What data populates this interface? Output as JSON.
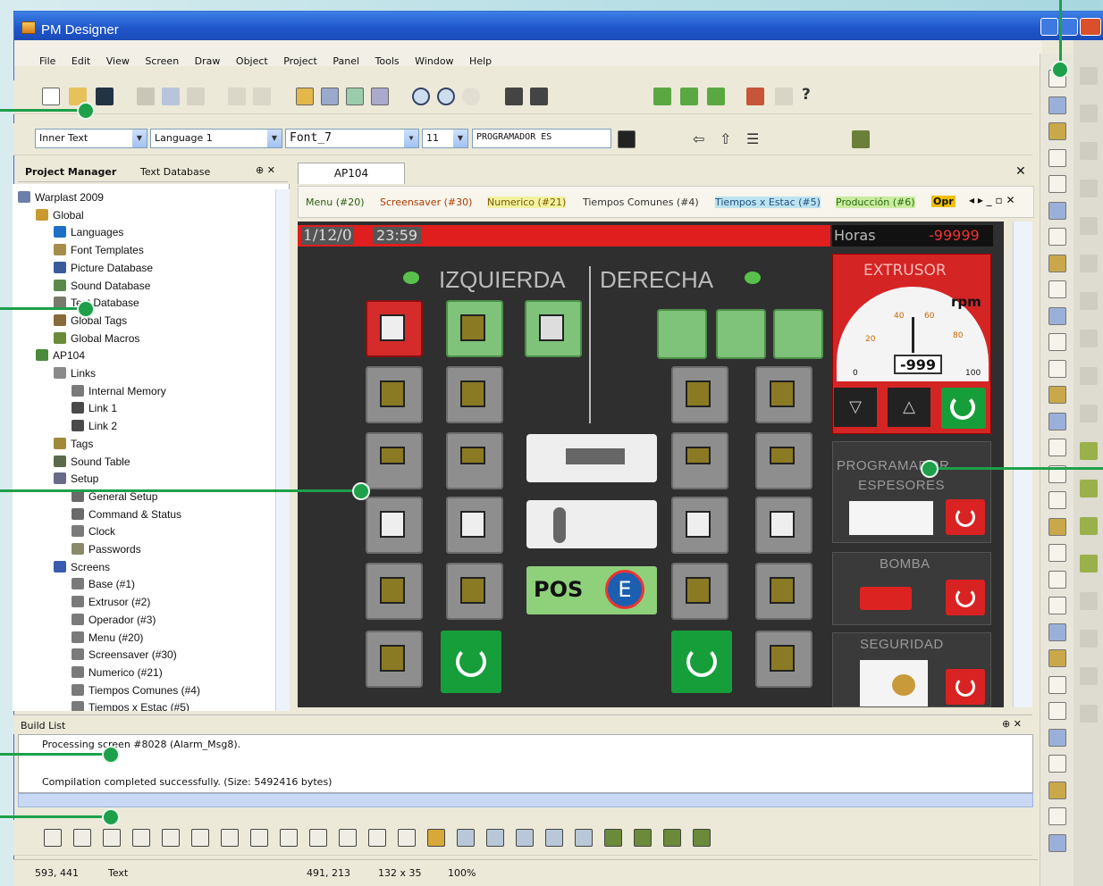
{
  "window": {
    "title": "PM Designer"
  },
  "menu": [
    "File",
    "Edit",
    "View",
    "Screen",
    "Draw",
    "Object",
    "Project",
    "Panel",
    "Tools",
    "Window",
    "Help"
  ],
  "toolbar2": {
    "inner_text": "Inner Text",
    "language": "Language 1",
    "font": "Font_7",
    "size": "11",
    "text": "PROGRAMADOR ES"
  },
  "project_manager": {
    "tab1": "Project Manager",
    "tab2": "Text Database",
    "tree": [
      "Warplast 2009",
      "Global",
      "Languages",
      "Font Templates",
      "Picture Database",
      "Sound Database",
      "Text Database",
      "Global Tags",
      "Global Macros",
      "AP104",
      "Links",
      "Internal Memory",
      "Link 1",
      "Link 2",
      "Tags",
      "Sound Table",
      "Setup",
      "General Setup",
      "Command & Status",
      "Clock",
      "Passwords",
      "Screens",
      "Base (#1)",
      "Extrusor (#2)",
      "Operador (#3)",
      "Menu (#20)",
      "Screensaver (#30)",
      "Numerico (#21)",
      "Tiempos Comunes (#4)",
      "Tiempos x Estac (#5)"
    ]
  },
  "editor": {
    "tab": "AP104",
    "screen_tabs": [
      "Menu (#20)",
      "Screensaver (#30)",
      "Numerico (#21)",
      "Tiempos Comunes (#4)",
      "Tiempos x Estac (#5)",
      "Producción (#6)",
      "Opr"
    ]
  },
  "hmi": {
    "date": "1/12/0",
    "time": "23:59",
    "horas_label": "Horas",
    "horas_value": "-99999",
    "left_label": "IZQUIERDA",
    "right_label": "DERECHA",
    "extrusor": "EXTRUSOR",
    "rpm": "rpm",
    "gauge_value": "-999",
    "gauge_ticks": [
      "0",
      "20",
      "40",
      "60",
      "80",
      "100"
    ],
    "programador1": "PROGRAMADOR",
    "programador2": "ESPESORES",
    "bomba": "BOMBA",
    "seguridad": "SEGURIDAD",
    "pos": "POS",
    "e": "E"
  },
  "build_list": {
    "title": "Build List",
    "line1": "Processing screen #8028 (Alarm_Msg8).",
    "line2": "Compilation completed successfully. (Size: 5492416 bytes)"
  },
  "status": {
    "coords": "593, 441",
    "type": "Text",
    "pos": "491, 213",
    "size": "132 x 35",
    "zoom": "100%"
  },
  "colors": {
    "accent": "#1ea04a",
    "title": "#1e55c9"
  }
}
